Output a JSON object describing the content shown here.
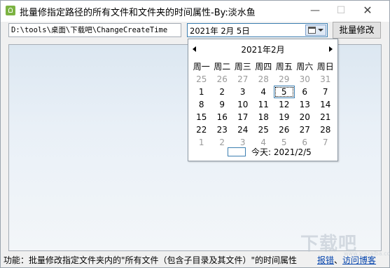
{
  "window": {
    "title": "批量修指定路径的所有文件和文件夹的时间属性-By:淡水鱼"
  },
  "controls": {
    "path": "D:\\tools\\桌面\\下载吧\\ChangeCreateTime",
    "date": "2021年 2月 5日",
    "batch_button": "批量修改"
  },
  "calendar": {
    "month_title": "2021年2月",
    "weekdays": [
      "周一",
      "周二",
      "周三",
      "周四",
      "周五",
      "周六",
      "周日"
    ],
    "weeks": [
      [
        "25",
        "26",
        "27",
        "28",
        "29",
        "30",
        "31"
      ],
      [
        "1",
        "2",
        "3",
        "4",
        "5",
        "6",
        "7"
      ],
      [
        "8",
        "9",
        "10",
        "11",
        "12",
        "13",
        "14"
      ],
      [
        "15",
        "16",
        "17",
        "18",
        "19",
        "20",
        "21"
      ],
      [
        "22",
        "23",
        "24",
        "25",
        "26",
        "27",
        "28"
      ],
      [
        "1",
        "2",
        "3",
        "4",
        "5",
        "6",
        "7"
      ]
    ],
    "selected_day": "5",
    "today_label": "今天: 2021/2/5"
  },
  "status": {
    "text": "功能：批量修改指定文件夹内的\"所有文件（包含子目录及其文件）\"的时间属性",
    "link_report": "报错",
    "separator": "、",
    "link_blog": "访问博客"
  },
  "watermark": {
    "text": "下载吧",
    "sub": "www.xiazaiba.com"
  }
}
